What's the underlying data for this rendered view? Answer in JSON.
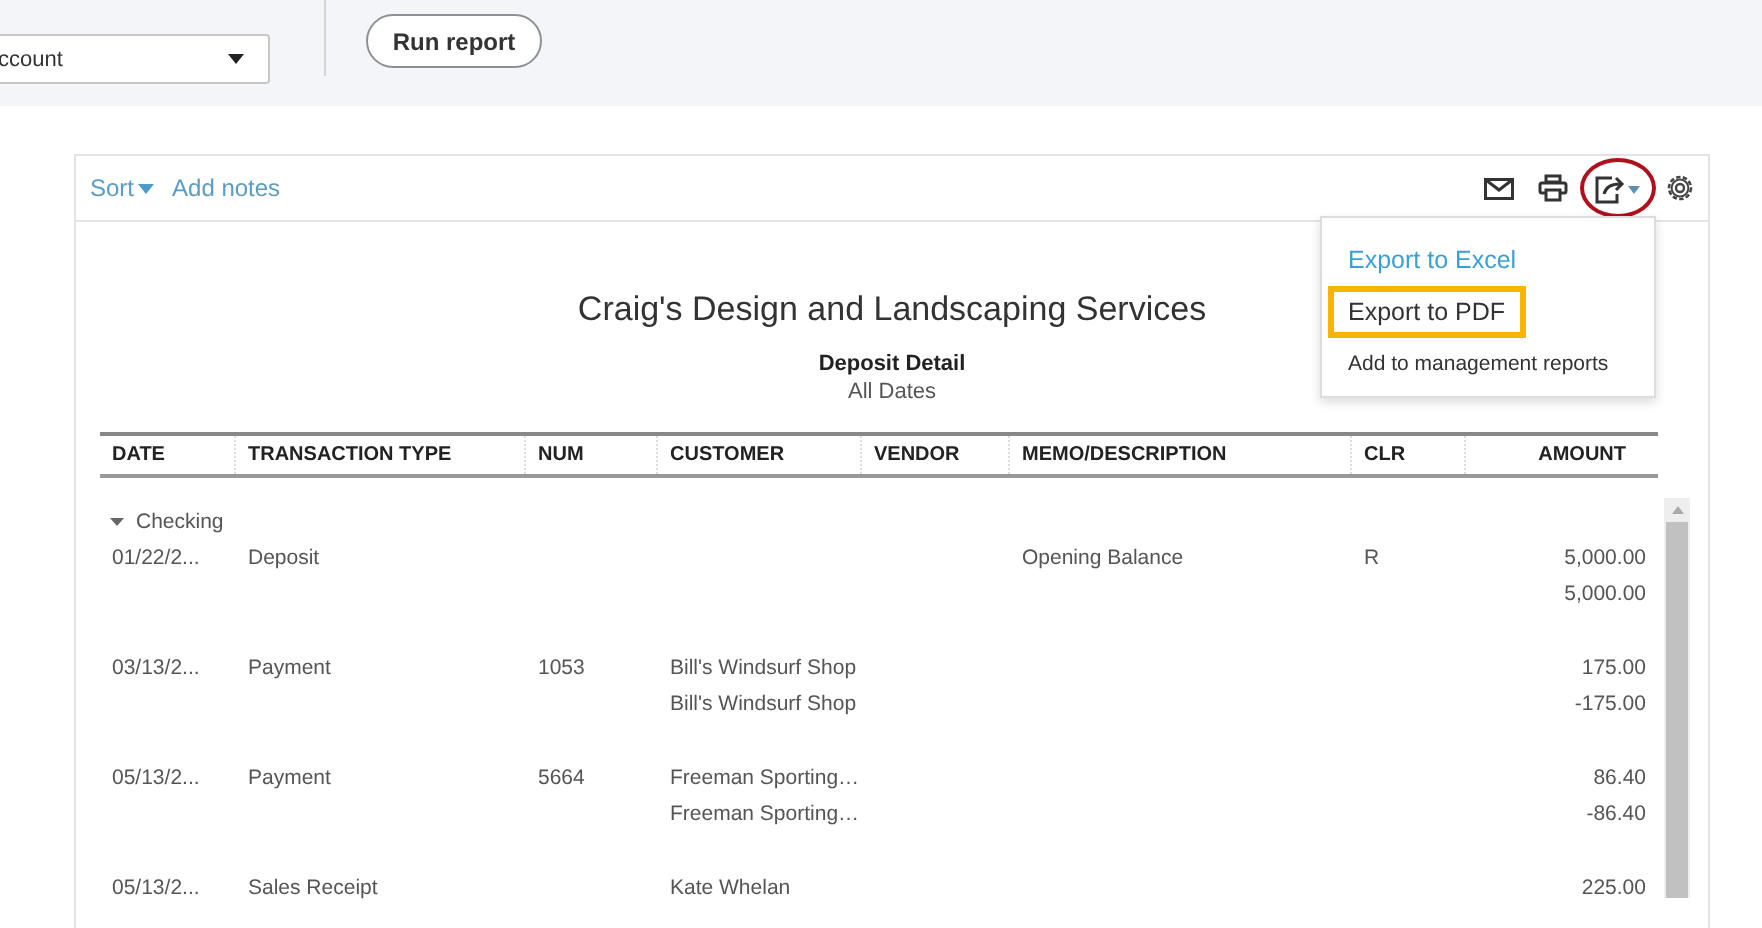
{
  "filter": {
    "account_value": "ccount",
    "run_button": "Run report"
  },
  "toolbar": {
    "sort": "Sort",
    "add_notes": "Add notes",
    "export_circled": true
  },
  "export_menu": [
    {
      "label": "Export to Excel",
      "kind": "link",
      "highlighted": false
    },
    {
      "label": "Export to PDF",
      "kind": "item",
      "highlighted": true
    },
    {
      "label": "Add to management reports",
      "kind": "small",
      "highlighted": false
    }
  ],
  "report": {
    "company": "Craig's Design and Landscaping Services",
    "title": "Deposit Detail",
    "period": "All Dates"
  },
  "table": {
    "columns": [
      "DATE",
      "TRANSACTION TYPE",
      "NUM",
      "CUSTOMER",
      "VENDOR",
      "MEMO/DESCRIPTION",
      "CLR",
      "AMOUNT"
    ],
    "group": {
      "label": "Checking",
      "expanded": true
    },
    "rows": [
      {
        "date": "01/22/2...",
        "type": "Deposit",
        "memo": "Opening Balance",
        "clr": "R",
        "amount": "5,000.00"
      },
      {
        "amount": "5,000.00"
      },
      {
        "date": "03/13/2...",
        "type": "Payment",
        "num": "1053",
        "customer": "Bill's Windsurf Shop",
        "amount": "175.00"
      },
      {
        "customer": "Bill's Windsurf Shop",
        "amount": "-175.00"
      },
      {
        "date": "05/13/2...",
        "type": "Payment",
        "num": "5664",
        "customer": "Freeman Sporting…",
        "amount": "86.40"
      },
      {
        "customer": "Freeman Sporting…",
        "amount": "-86.40"
      },
      {
        "date": "05/13/2...",
        "type": "Sales Receipt",
        "customer": "Kate Whelan",
        "amount": "225.00"
      }
    ]
  }
}
